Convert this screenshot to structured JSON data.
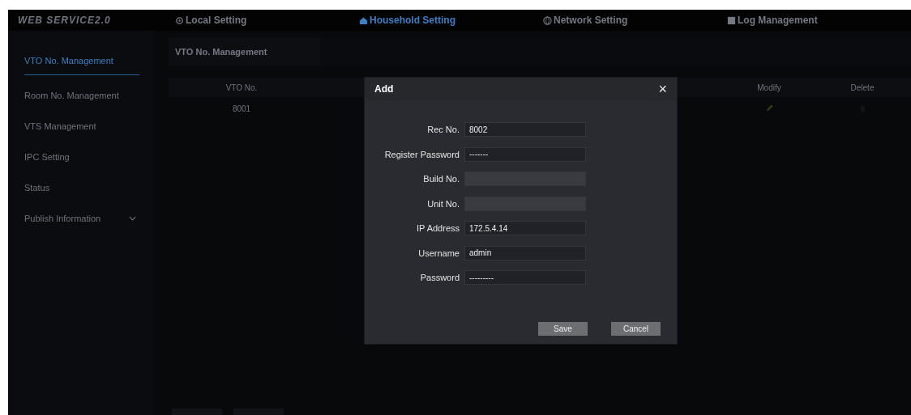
{
  "brand": "WEB SERVICE2.0",
  "nav_tabs": [
    {
      "label": "Local Setting",
      "selected": false
    },
    {
      "label": "Household Setting",
      "selected": true
    },
    {
      "label": "Network Setting",
      "selected": false
    },
    {
      "label": "Log Management",
      "selected": false
    }
  ],
  "sidebar": {
    "items": [
      {
        "label": "VTO No. Management",
        "selected": true,
        "expandable": false
      },
      {
        "label": "Room No. Management",
        "selected": false,
        "expandable": false
      },
      {
        "label": "VTS Management",
        "selected": false,
        "expandable": false
      },
      {
        "label": "IPC Setting",
        "selected": false,
        "expandable": false
      },
      {
        "label": "Status",
        "selected": false,
        "expandable": false
      },
      {
        "label": "Publish Information",
        "selected": false,
        "expandable": true
      }
    ]
  },
  "content_tab": "VTO No. Management",
  "table": {
    "columns": [
      "VTO No.",
      "Modify",
      "Delete"
    ],
    "rows": [
      {
        "vto_no": "8001"
      }
    ]
  },
  "dialog": {
    "title": "Add",
    "close": "×",
    "fields": [
      {
        "label": "Rec No.",
        "value": "8002",
        "disabled": false
      },
      {
        "label": "Register Password",
        "value": "-------",
        "disabled": false
      },
      {
        "label": "Build No.",
        "disabled": true
      },
      {
        "label": "Unit No.",
        "disabled": true
      },
      {
        "label": "IP Address",
        "value": "172.5.4.14",
        "disabled": false
      },
      {
        "label": "Username",
        "value": "admin",
        "disabled": false
      },
      {
        "label": "Password",
        "value": "---------",
        "disabled": false
      }
    ],
    "buttons": [
      "Save",
      "Cancel"
    ]
  }
}
